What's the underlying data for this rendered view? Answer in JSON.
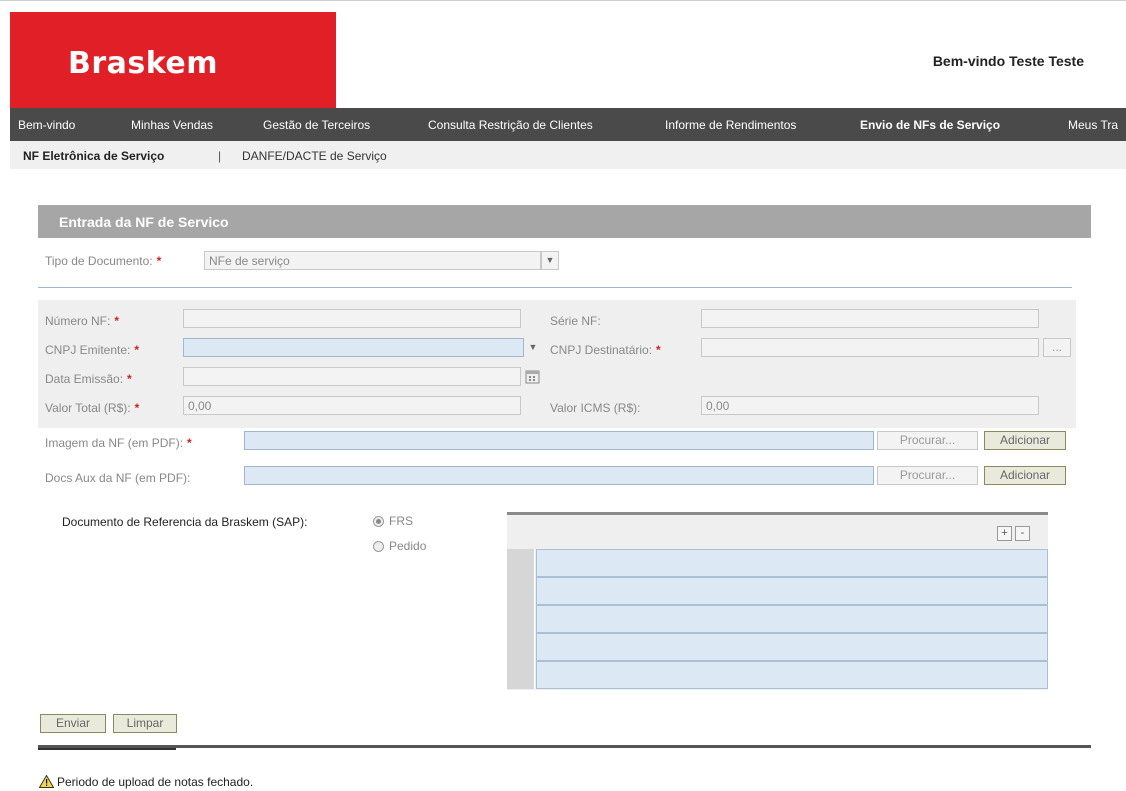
{
  "header": {
    "logo_text": "Braskem",
    "welcome": "Bem-vindo Teste Teste",
    "brand_color": "#e11f26"
  },
  "nav": {
    "items": [
      "Bem-vindo",
      "Minhas Vendas",
      "Gestão de Terceiros",
      "Consulta Restrição de Clientes",
      "Informe de Rendimentos",
      "Envio de NFs de Serviço",
      "Meus Tra"
    ],
    "active_index": 5
  },
  "subnav": {
    "items": [
      "NF Eletrônica de Serviço",
      "DANFE/DACTE de Serviço"
    ],
    "separator": "|"
  },
  "form": {
    "title": "Entrada da NF de Servico",
    "tipo_documento": {
      "label": "Tipo de Documento:",
      "value": "NFe de serviço"
    },
    "numero_nf": {
      "label": "Número NF:",
      "value": ""
    },
    "serie_nf": {
      "label": "Série NF:",
      "value": ""
    },
    "cnpj_emitente": {
      "label": "CNPJ Emitente:",
      "value": ""
    },
    "cnpj_destinatario": {
      "label": "CNPJ Destinatário:",
      "value": "",
      "button": "..."
    },
    "data_emissao": {
      "label": "Data Emissão:",
      "value": ""
    },
    "valor_total": {
      "label": "Valor Total (R$):",
      "value": "0,00"
    },
    "valor_icms": {
      "label": "Valor ICMS (R$):",
      "value": "0,00"
    },
    "imagem_nf": {
      "label": "Imagem da NF (em PDF):",
      "value": "",
      "browse": "Procurar...",
      "add": "Adicionar"
    },
    "docs_aux": {
      "label": "Docs Aux da NF (em PDF):",
      "value": "",
      "browse": "Procurar...",
      "add": "Adicionar"
    },
    "required_marker": "*",
    "doc_ref": {
      "label": "Documento de Referencia da Braskem (SAP):",
      "options": [
        "FRS",
        "Pedido"
      ],
      "selected": "FRS"
    },
    "table": {
      "add": "+",
      "remove": "-",
      "rows": [
        "",
        "",
        "",
        "",
        ""
      ]
    },
    "actions": {
      "send": "Enviar",
      "clear": "Limpar"
    }
  },
  "status": {
    "message": "Periodo de upload de notas fechado.",
    "icon": "warning-icon"
  }
}
